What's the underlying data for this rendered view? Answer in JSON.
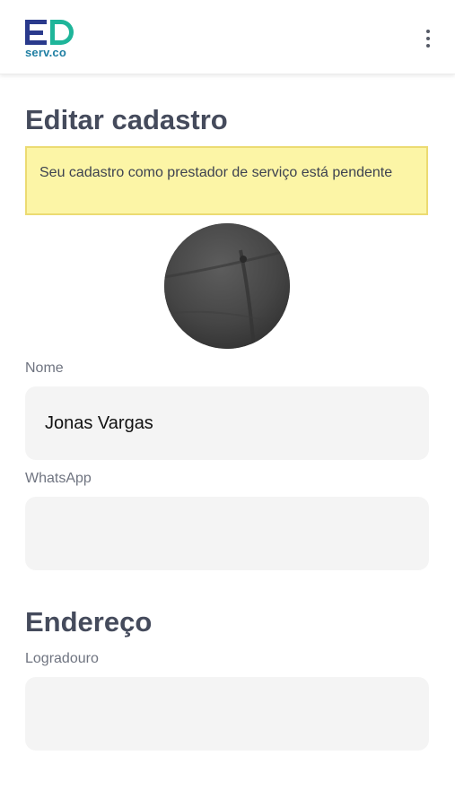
{
  "header": {
    "logo_text": "serv.co",
    "menu_icon": "more-vert-icon"
  },
  "page": {
    "title": "Editar cadastro"
  },
  "alert": {
    "message": "Seu cadastro como prestador de serviço está pendente",
    "background": "#fcf5a6",
    "border": "#ecdb72"
  },
  "form": {
    "nome": {
      "label": "Nome",
      "value": "Jonas Vargas"
    },
    "whatsapp": {
      "label": "WhatsApp",
      "value": ""
    }
  },
  "address": {
    "title": "Endereço",
    "logradouro": {
      "label": "Logradouro",
      "value": ""
    }
  },
  "colors": {
    "brand_navy": "#2a3a8c",
    "brand_teal": "#1fb59a",
    "title": "#454b5c",
    "field_bg": "#f4f4f4"
  }
}
